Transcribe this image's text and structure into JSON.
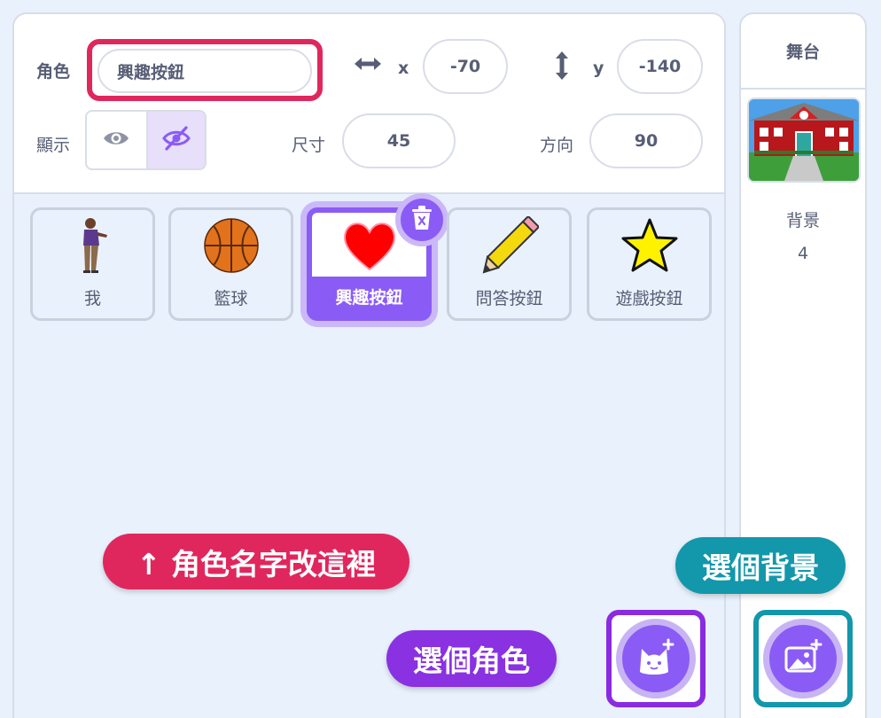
{
  "sprite_info": {
    "sprite_label": "角色",
    "sprite_name": "興趣按鈕",
    "x_label": "x",
    "x_value": "-70",
    "y_label": "y",
    "y_value": "-140",
    "show_label": "顯示",
    "show_state": "hidden",
    "size_label": "尺寸",
    "size_value": "45",
    "direction_label": "方向",
    "direction_value": "90"
  },
  "sprites": [
    {
      "name": "我",
      "icon": "person-sprite-icon"
    },
    {
      "name": "籃球",
      "icon": "basketball-sprite-icon"
    },
    {
      "name": "興趣按鈕",
      "icon": "heart-sprite-icon",
      "selected": true
    },
    {
      "name": "問答按鈕",
      "icon": "pencil-sprite-icon"
    },
    {
      "name": "遊戲按鈕",
      "icon": "star-sprite-icon"
    }
  ],
  "stage": {
    "title": "舞台",
    "backdrop_label": "背景",
    "backdrop_count": "4",
    "thumbnail_icon": "school-backdrop-icon"
  },
  "annotations": {
    "sprite_name_hint": "↑ 角色名字改這裡",
    "choose_backdrop": "選個背景",
    "choose_sprite": "選個角色"
  },
  "colors": {
    "accent_purple": "#8a5cf5",
    "highlight_pink": "#e0275d",
    "highlight_teal": "#1397ab",
    "highlight_violet": "#8a2be2"
  }
}
